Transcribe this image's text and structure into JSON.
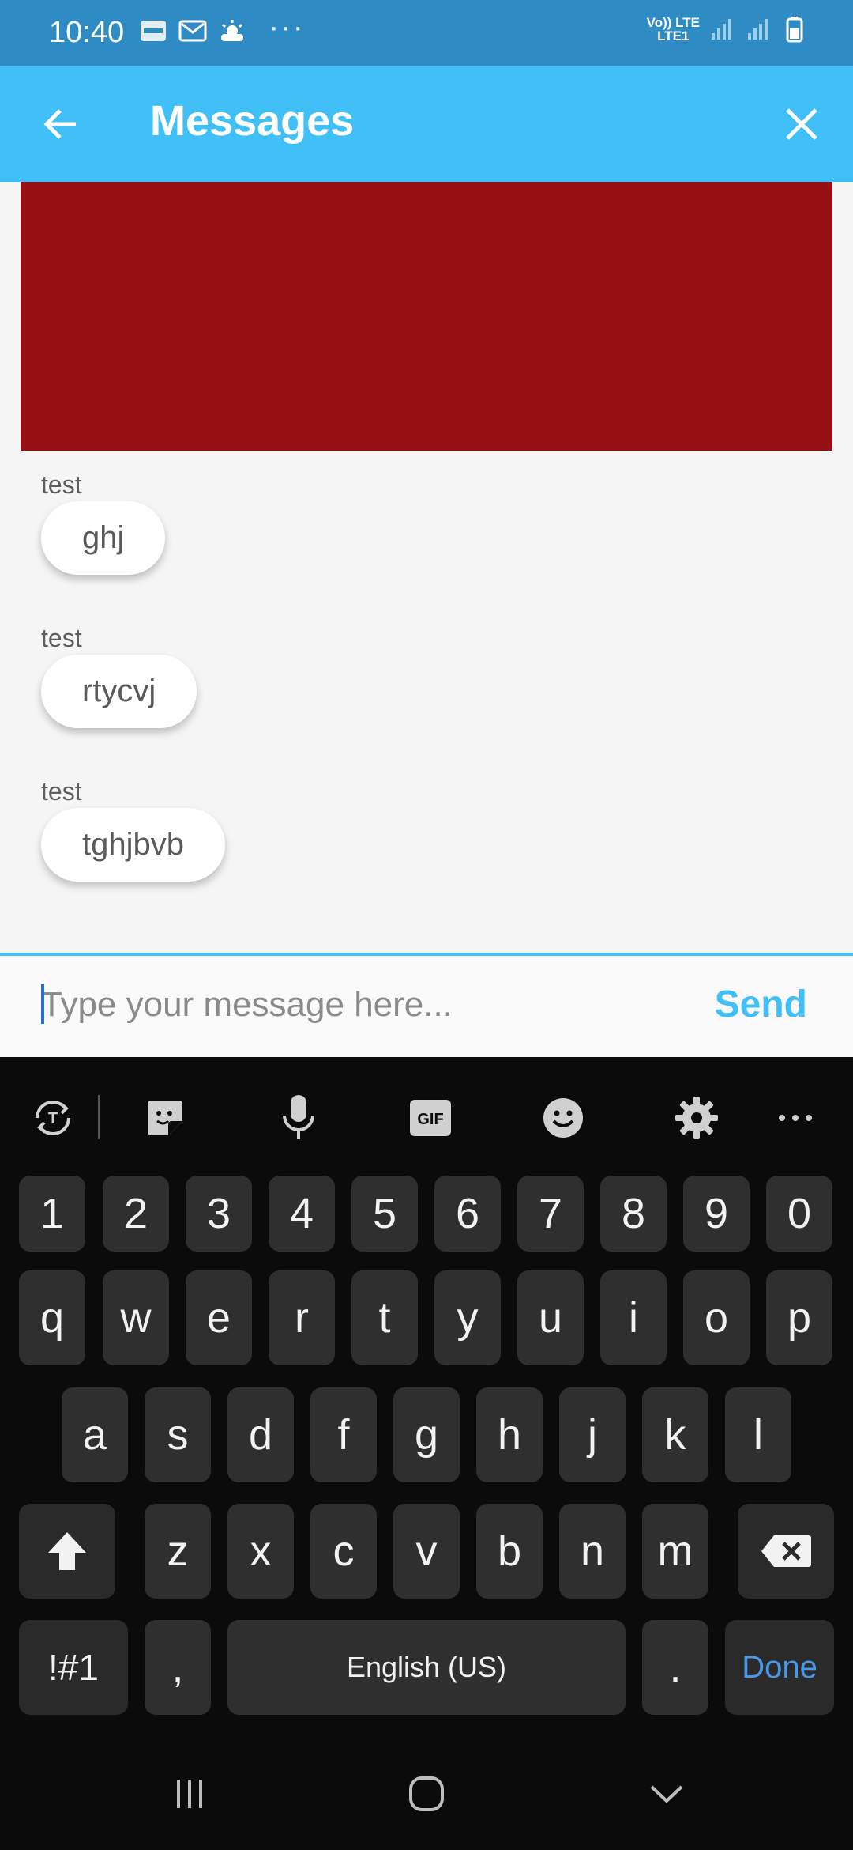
{
  "status_bar": {
    "time": "10:40",
    "left_icons": [
      "paytm-icon",
      "mail-icon",
      "weather-icon"
    ],
    "more": "···",
    "network_line1": "Vo)) LTE",
    "network_line2": "LTE1"
  },
  "app_bar": {
    "title": "Messages",
    "color": "#40c0f7"
  },
  "messages": [
    {
      "sender": "test",
      "text": "ghj"
    },
    {
      "sender": "test",
      "text": "rtycvj"
    },
    {
      "sender": "test",
      "text": "tghjbvb"
    }
  ],
  "media_block_color": "#960f12",
  "composer": {
    "placeholder": "Type your message here...",
    "send_label": "Send"
  },
  "keyboard": {
    "toolbar": [
      "translate-icon",
      "sticker-icon",
      "microphone-icon",
      "gif-icon",
      "emoji-icon",
      "settings-icon",
      "more-icon"
    ],
    "gif_label": "GIF",
    "row_numbers": [
      "1",
      "2",
      "3",
      "4",
      "5",
      "6",
      "7",
      "8",
      "9",
      "0"
    ],
    "row1": [
      "q",
      "w",
      "e",
      "r",
      "t",
      "y",
      "u",
      "i",
      "o",
      "p"
    ],
    "row2": [
      "a",
      "s",
      "d",
      "f",
      "g",
      "h",
      "j",
      "k",
      "l"
    ],
    "row3": [
      "z",
      "x",
      "c",
      "v",
      "b",
      "n",
      "m"
    ],
    "symbols_label": "!#1",
    "comma_label": ",",
    "space_label": "English (US)",
    "period_label": ".",
    "done_label": "Done"
  },
  "nav_bar": [
    "recents-icon",
    "home-icon",
    "hide-keyboard-icon"
  ]
}
